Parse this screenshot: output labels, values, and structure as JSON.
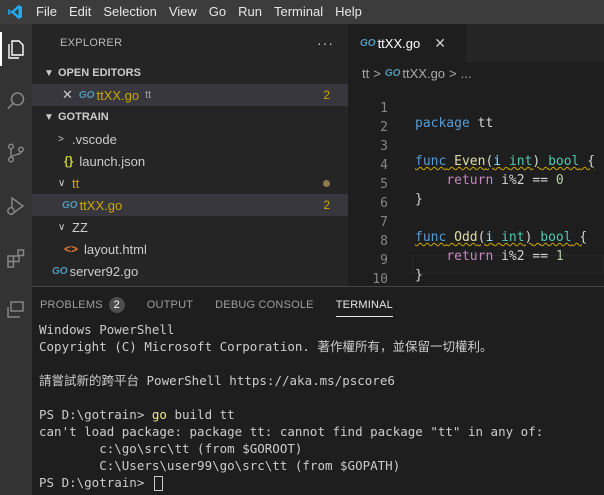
{
  "menu": [
    "File",
    "Edit",
    "Selection",
    "View",
    "Go",
    "Run",
    "Terminal",
    "Help"
  ],
  "activity_icons": [
    "explorer-icon",
    "search-icon",
    "source-control-icon",
    "run-debug-icon",
    "extensions-icon",
    "remote-icon"
  ],
  "explorer": {
    "title": "EXPLORER",
    "more": "···",
    "open_editors_label": "OPEN EDITORS",
    "open_editor": {
      "close": "✕",
      "go": "GO",
      "name": "ttXX.go",
      "folder": "tt",
      "problems": "2"
    },
    "workspace_label": "GOTRAIN",
    "tree": {
      "vscode": {
        "name": ".vscode"
      },
      "launch": {
        "name": "launch.json"
      },
      "tt": {
        "name": "tt"
      },
      "ttxx": {
        "go": "GO",
        "name": "ttXX.go",
        "problems": "2"
      },
      "zz": {
        "name": "ZZ"
      },
      "layout": {
        "name": "layout.html"
      },
      "server": {
        "go": "GO",
        "name": "server92.go"
      }
    }
  },
  "tab": {
    "go": "GO",
    "name": "ttXX.go",
    "close": "✕"
  },
  "breadcrumb": {
    "folder": "tt",
    "go": "GO",
    "file": "ttXX.go",
    "more": "..."
  },
  "code_lines": {
    "l1": {
      "n": "1",
      "kw": "package",
      "rest": " tt"
    },
    "l2": {
      "n": "2"
    },
    "l3": {
      "n": "3",
      "kw": "func",
      "fn": "Even",
      "p1": "(",
      "param": "i",
      "ty": "int",
      "p2": ")",
      "ret": "bool",
      "brace": " {"
    },
    "l4": {
      "n": "4",
      "indent": "    ",
      "kw": "return",
      "expr": " i%2 == ",
      "num": "0"
    },
    "l5": {
      "n": "5",
      "text": "}"
    },
    "l6": {
      "n": "6"
    },
    "l7": {
      "n": "7",
      "kw": "func",
      "fn": "Odd",
      "p1": "(",
      "param": "i",
      "ty": "int",
      "p2": ")",
      "ret": "bool",
      "brace": " {"
    },
    "l8": {
      "n": "8",
      "indent": "    ",
      "kw": "return",
      "expr": " i%2 == ",
      "num": "1"
    },
    "l9": {
      "n": "9",
      "text": "}"
    },
    "l10": {
      "n": "10"
    }
  },
  "panel": {
    "tabs": {
      "problems": "PROBLEMS",
      "problems_count": "2",
      "output": "OUTPUT",
      "debug": "DEBUG CONSOLE",
      "terminal": "TERMINAL"
    },
    "terminal": {
      "l1": "Windows PowerShell",
      "l2": "Copyright (C) Microsoft Corporation. 著作權所有，並保留一切權利。",
      "l3": "",
      "l4": "請嘗試新的跨平台 PowerShell https://aka.ms/pscore6",
      "l5": "",
      "l6_prompt": "PS D:\\gotrain> ",
      "l6_cmd": "go",
      "l6_args": " build tt",
      "l7": "can't load package: package tt: cannot find package \"tt\" in any of:",
      "l8": "        c:\\go\\src\\tt (from $GOROOT)",
      "l9": "        C:\\Users\\user99\\go\\src\\tt (from $GOPATH)",
      "l10_prompt": "PS D:\\gotrain> "
    }
  },
  "colors": {
    "accent": "#007acc",
    "warning": "#cca700",
    "go_blue": "#519aba"
  }
}
